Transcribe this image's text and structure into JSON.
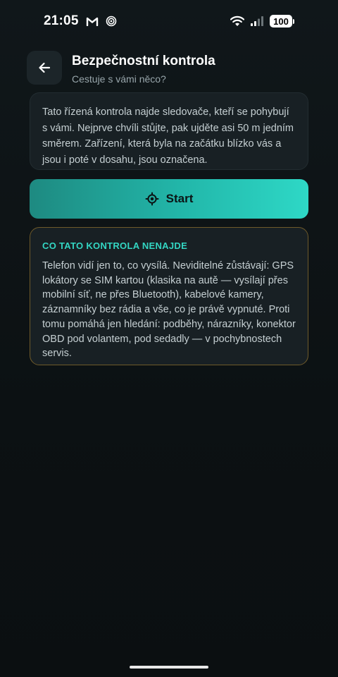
{
  "status_bar": {
    "time": "21:05",
    "mail_icon": "gmail-icon",
    "sync_icon": "sync-status-icon",
    "wifi_icon": "wifi-icon",
    "signal_icon": "cellular-signal-icon",
    "battery": "100"
  },
  "header": {
    "back_icon": "arrow-left-icon",
    "title": "Bezpečnostní kontrola",
    "subtitle": "Cestuje s vámi něco?"
  },
  "info_card": {
    "text": "Tato řízená kontrola najde sledovače, kteří se pohybují s vámi. Nejprve chvíli stůjte, pak ujděte asi 50 m jedním směrem. Zařízení, která byla na začátku blízko vás a jsou i poté v dosahu, jsou označena."
  },
  "start_button": {
    "icon": "crosshair-icon",
    "label": "Start"
  },
  "warning_card": {
    "heading": "CO TATO KONTROLA NENAJDE",
    "text": "Telefon vidí jen to, co vysílá. Neviditelné zůstávají: GPS lokátory se SIM kartou (klasika na autě — vysílají přes mobilní síť, ne přes Bluetooth), kabelové kamery, záznamníky bez rádia a vše, co je právě vypnuté. Proti tomu pomáhá jen hledání: podběhy, nárazníky, konektor OBD pod volantem, pod sedadly — v pochybnostech servis."
  },
  "colors": {
    "accent": "#2ed8c6",
    "warning_border": "#6e5a2a",
    "card_bg": "#182024",
    "background": "#0d1215"
  }
}
